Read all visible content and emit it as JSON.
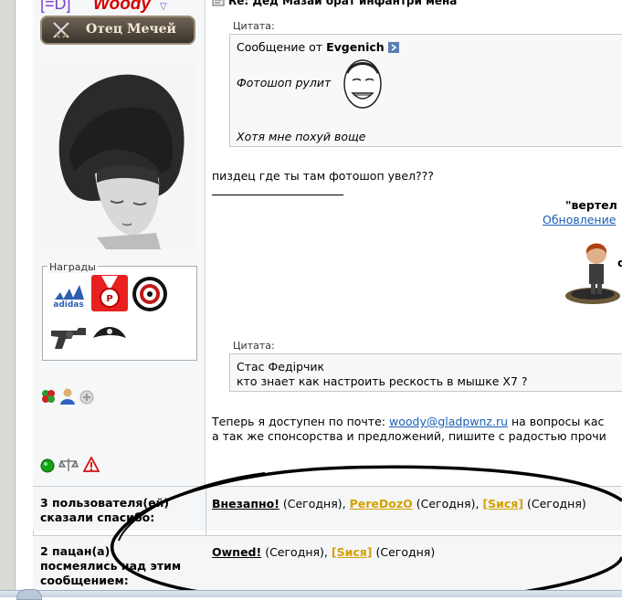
{
  "post": {
    "title_fragment": "Re: Дед Мазаи брат инфантри мена",
    "username": "Woody",
    "clan_tag": "[=D]",
    "rank": "Отец Мечей",
    "awards_label": "Награды"
  },
  "quote1": {
    "label": "Цитата:",
    "from_prefix": "Сообщение от",
    "from_user": "Evgenich",
    "line1": "Фотошоп рулит",
    "line2": "Хотя мне похуй воще"
  },
  "reply_text": "пиздец где ты там фотошоп увел???",
  "signature": {
    "quote_fragment": "\"вертел",
    "update_link": "Обновление",
    "quote_label": "Цитата:",
    "quote_author": "Стас Федірчик",
    "quote_text": "кто знает как настроить рескость в мышке X7 ?",
    "contact_prefix": "Теперь я доступен по почте:",
    "email": "woody@gladpwnz.ru",
    "contact_suffix": "на вопросы кас",
    "contact_line2": "а так же спонсорства и предложений, пишите с радостью прочи"
  },
  "thanks_row": {
    "label_line1": "3 пользователя(ей)",
    "label_line2": "сказали спасибо:",
    "users": [
      {
        "name": "Внезапно!",
        "when": "(Сегодня),"
      },
      {
        "name": "PereDozO",
        "when": "(Сегодня),"
      },
      {
        "name": "[Sися]",
        "when": "(Сегодня)"
      }
    ]
  },
  "laugh_row": {
    "label_line1": "2 пацан(а)",
    "label_line2": "посмеялись над этим",
    "label_line3": "сообщением:",
    "users": [
      {
        "name": "Owned!",
        "when": "(Сегодня),"
      },
      {
        "name": "[Sися]",
        "when": "(Сегодня)"
      }
    ]
  },
  "colors": {
    "username": "#d40000",
    "link_blue": "#1a5fb4",
    "link_gold": "#d4a000",
    "annotation": "#000000"
  },
  "icons": [
    "clover-icon",
    "user-icon",
    "contact-icon",
    "online-icon",
    "scales-icon",
    "warning-icon",
    "post-icon",
    "arrow-icon"
  ]
}
